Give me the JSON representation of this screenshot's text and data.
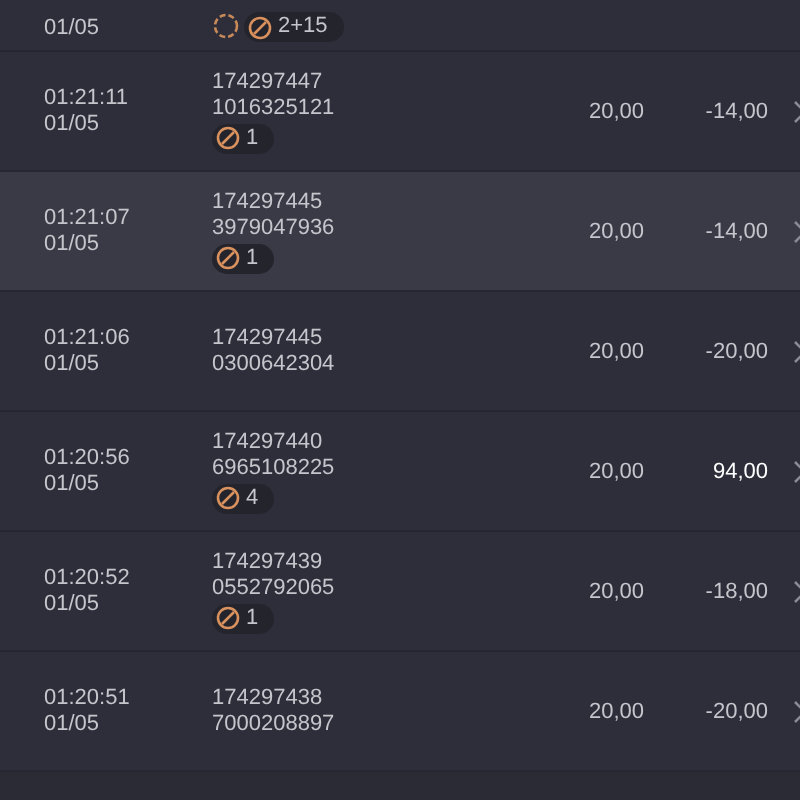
{
  "top_row": {
    "date": "01/05",
    "badges": [
      {
        "kind": "spinner"
      },
      {
        "kind": "ball",
        "count": "2+15"
      }
    ]
  },
  "rows": [
    {
      "time": "01:21:11",
      "date": "01/05",
      "id_1": "174297447",
      "id_2": "1016325121",
      "badge": "1",
      "stake": "20,00",
      "result": "-14,00",
      "win": false,
      "selected": false
    },
    {
      "time": "01:21:07",
      "date": "01/05",
      "id_1": "174297445",
      "id_2": "3979047936",
      "badge": "1",
      "stake": "20,00",
      "result": "-14,00",
      "win": false,
      "selected": true
    },
    {
      "time": "01:21:06",
      "date": "01/05",
      "id_1": "174297445",
      "id_2": "0300642304",
      "stake": "20,00",
      "result": "-20,00",
      "win": false,
      "selected": false
    },
    {
      "time": "01:20:56",
      "date": "01/05",
      "id_1": "174297440",
      "id_2": "6965108225",
      "badge": "4",
      "stake": "20,00",
      "result": "94,00",
      "win": true,
      "selected": false
    },
    {
      "time": "01:20:52",
      "date": "01/05",
      "id_1": "174297439",
      "id_2": "0552792065",
      "badge": "1",
      "stake": "20,00",
      "result": "-18,00",
      "win": false,
      "selected": false
    },
    {
      "time": "01:20:51",
      "date": "01/05",
      "id_1": "174297438",
      "id_2": "7000208897",
      "stake": "20,00",
      "result": "-20,00",
      "win": false,
      "selected": false
    }
  ]
}
